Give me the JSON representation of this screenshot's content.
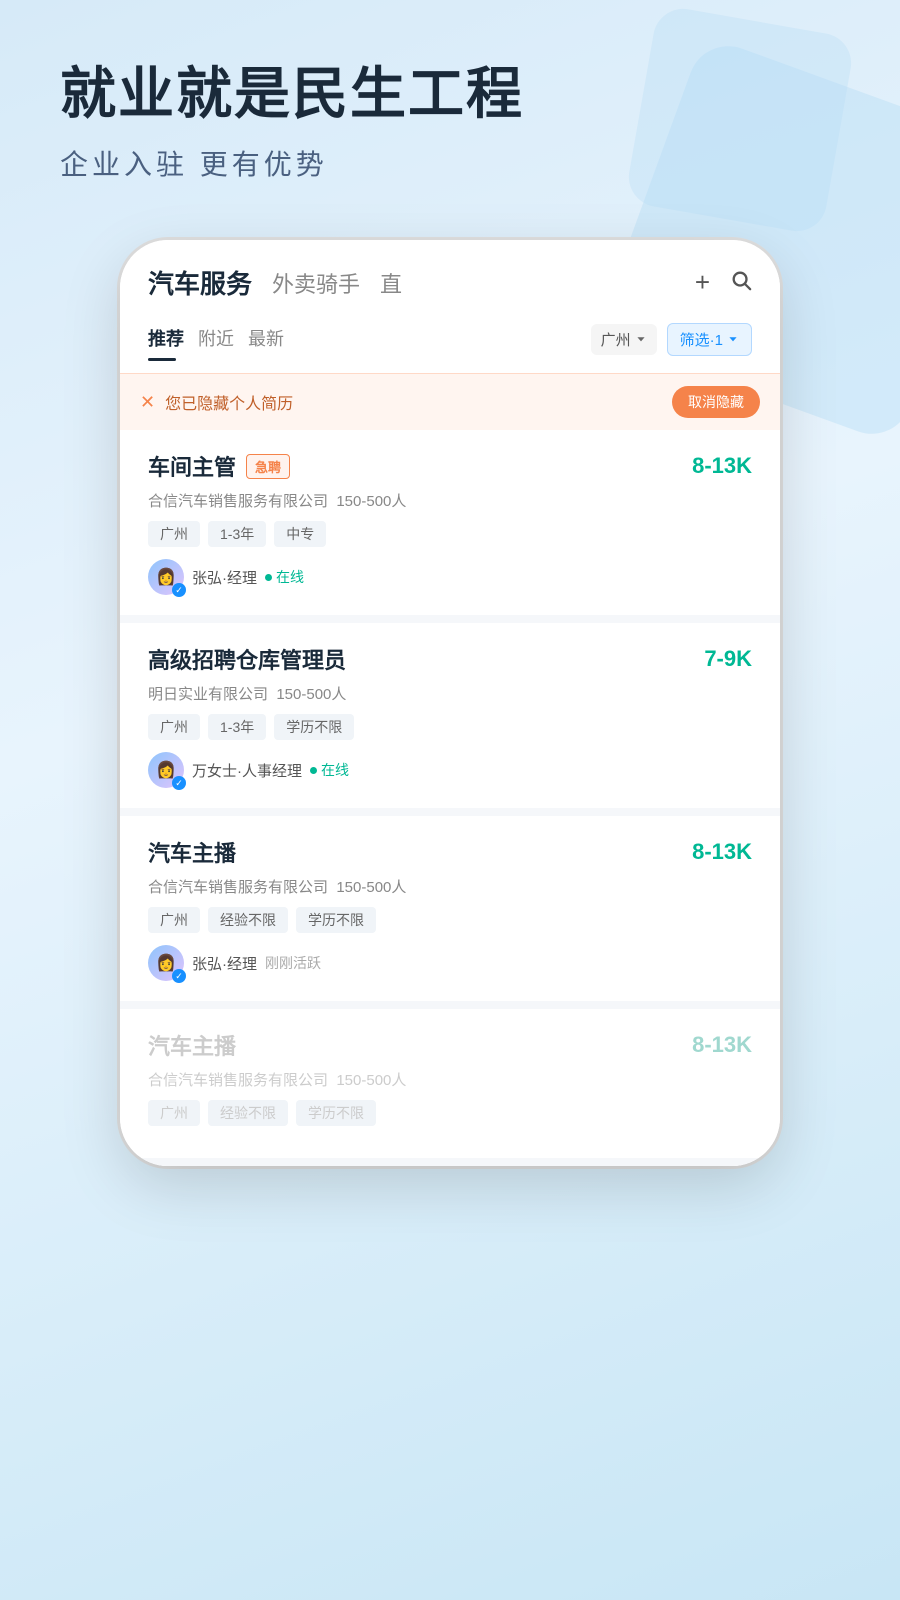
{
  "hero": {
    "title": "就业就是民生工程",
    "subtitle": "企业入驻 更有优势"
  },
  "app": {
    "nav": {
      "category_main": "汽车服务",
      "category_secondary": "外卖骑手",
      "category_live": "直",
      "plus_icon": "+",
      "search_icon": "🔍"
    },
    "tabs": [
      {
        "label": "推荐",
        "active": true
      },
      {
        "label": "附近",
        "active": false
      },
      {
        "label": "最新",
        "active": false
      }
    ],
    "location": "广州",
    "filter_label": "筛选·1"
  },
  "resume_banner": {
    "text": "您已隐藏个人简历",
    "cancel_label": "取消隐藏"
  },
  "jobs": [
    {
      "title": "车间主管",
      "urgent": true,
      "urgent_label": "急聘",
      "salary": "8-13K",
      "company": "合信汽车销售服务有限公司",
      "size": "150-500人",
      "tags": [
        "广州",
        "1-3年",
        "中专"
      ],
      "recruiter_name": "张弘·经理",
      "online": true,
      "online_label": "在线",
      "recent": ""
    },
    {
      "title": "高级招聘仓库管理员",
      "urgent": false,
      "urgent_label": "",
      "salary": "7-9K",
      "company": "明日实业有限公司",
      "size": "150-500人",
      "tags": [
        "广州",
        "1-3年",
        "学历不限"
      ],
      "recruiter_name": "万女士·人事经理",
      "online": true,
      "online_label": "在线",
      "recent": ""
    },
    {
      "title": "汽车主播",
      "urgent": false,
      "urgent_label": "",
      "salary": "8-13K",
      "company": "合信汽车销售服务有限公司",
      "size": "150-500人",
      "tags": [
        "广州",
        "经验不限",
        "学历不限"
      ],
      "recruiter_name": "张弘·经理",
      "online": false,
      "online_label": "",
      "recent": "刚刚活跃"
    },
    {
      "title": "汽车主播",
      "urgent": false,
      "urgent_label": "",
      "salary": "8-13K",
      "company": "合信汽车销售服务有限公司",
      "size": "150-500人",
      "tags": [
        "广州",
        "经验不限",
        "学历不限"
      ],
      "recruiter_name": "",
      "online": false,
      "online_label": "",
      "recent": "",
      "faded": true
    }
  ]
}
